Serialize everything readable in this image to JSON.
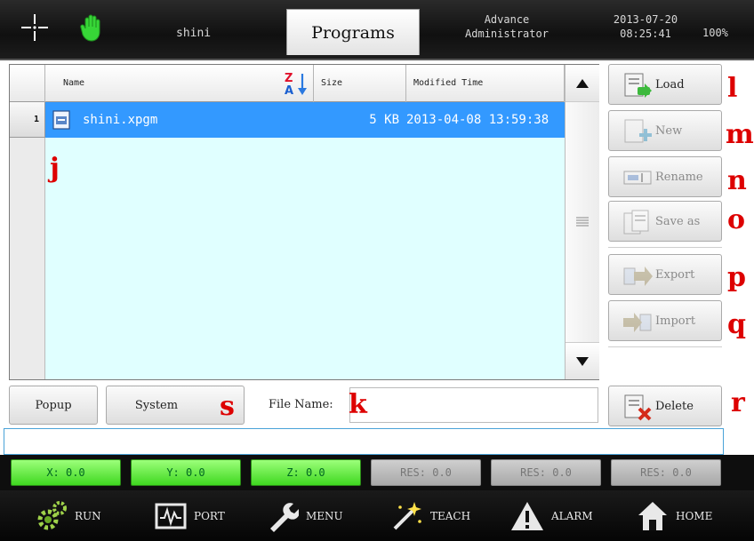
{
  "header": {
    "user": "shini",
    "active_tab": "Programs",
    "role_line1": "Advance",
    "role_line2": "Administrator",
    "date": "2013-07-20",
    "time": "08:25:41",
    "percent": "100%"
  },
  "table": {
    "columns": {
      "name": "Name",
      "size": "Size",
      "modified": "Modified Time"
    },
    "rows": [
      {
        "index": "1",
        "name": "shini.xpgm",
        "size": "5 KB",
        "modified": "2013-04-08 13:59:38",
        "selected": true
      }
    ]
  },
  "side_buttons": {
    "load": "Load",
    "new": "New",
    "rename": "Rename",
    "save_as": "Save as",
    "export": "Export",
    "import": "Import",
    "delete": "Delete"
  },
  "bottom": {
    "popup": "Popup",
    "system": "System",
    "file_name_label": "File Name:",
    "file_name_value": ""
  },
  "annotations": {
    "j": "j",
    "k": "k",
    "l": "l",
    "m": "m",
    "n": "n",
    "o": "o",
    "p": "p",
    "q": "q",
    "r": "r",
    "s": "s"
  },
  "coordinates": [
    {
      "label": "X: 0.0",
      "active": true
    },
    {
      "label": "Y: 0.0",
      "active": true
    },
    {
      "label": "Z: 0.0",
      "active": true
    },
    {
      "label": "RES: 0.0",
      "active": false
    },
    {
      "label": "RES: 0.0",
      "active": false
    },
    {
      "label": "RES: 0.0",
      "active": false
    }
  ],
  "nav": {
    "run": "RUN",
    "port": "PORT",
    "menu": "MENU",
    "teach": "TEACH",
    "alarm": "ALARM",
    "home": "HOME"
  },
  "colors": {
    "selected_row": "#3399ff",
    "table_bg": "#e0ffff",
    "active_coord": "#3fd820",
    "annotation": "#dd0000"
  }
}
